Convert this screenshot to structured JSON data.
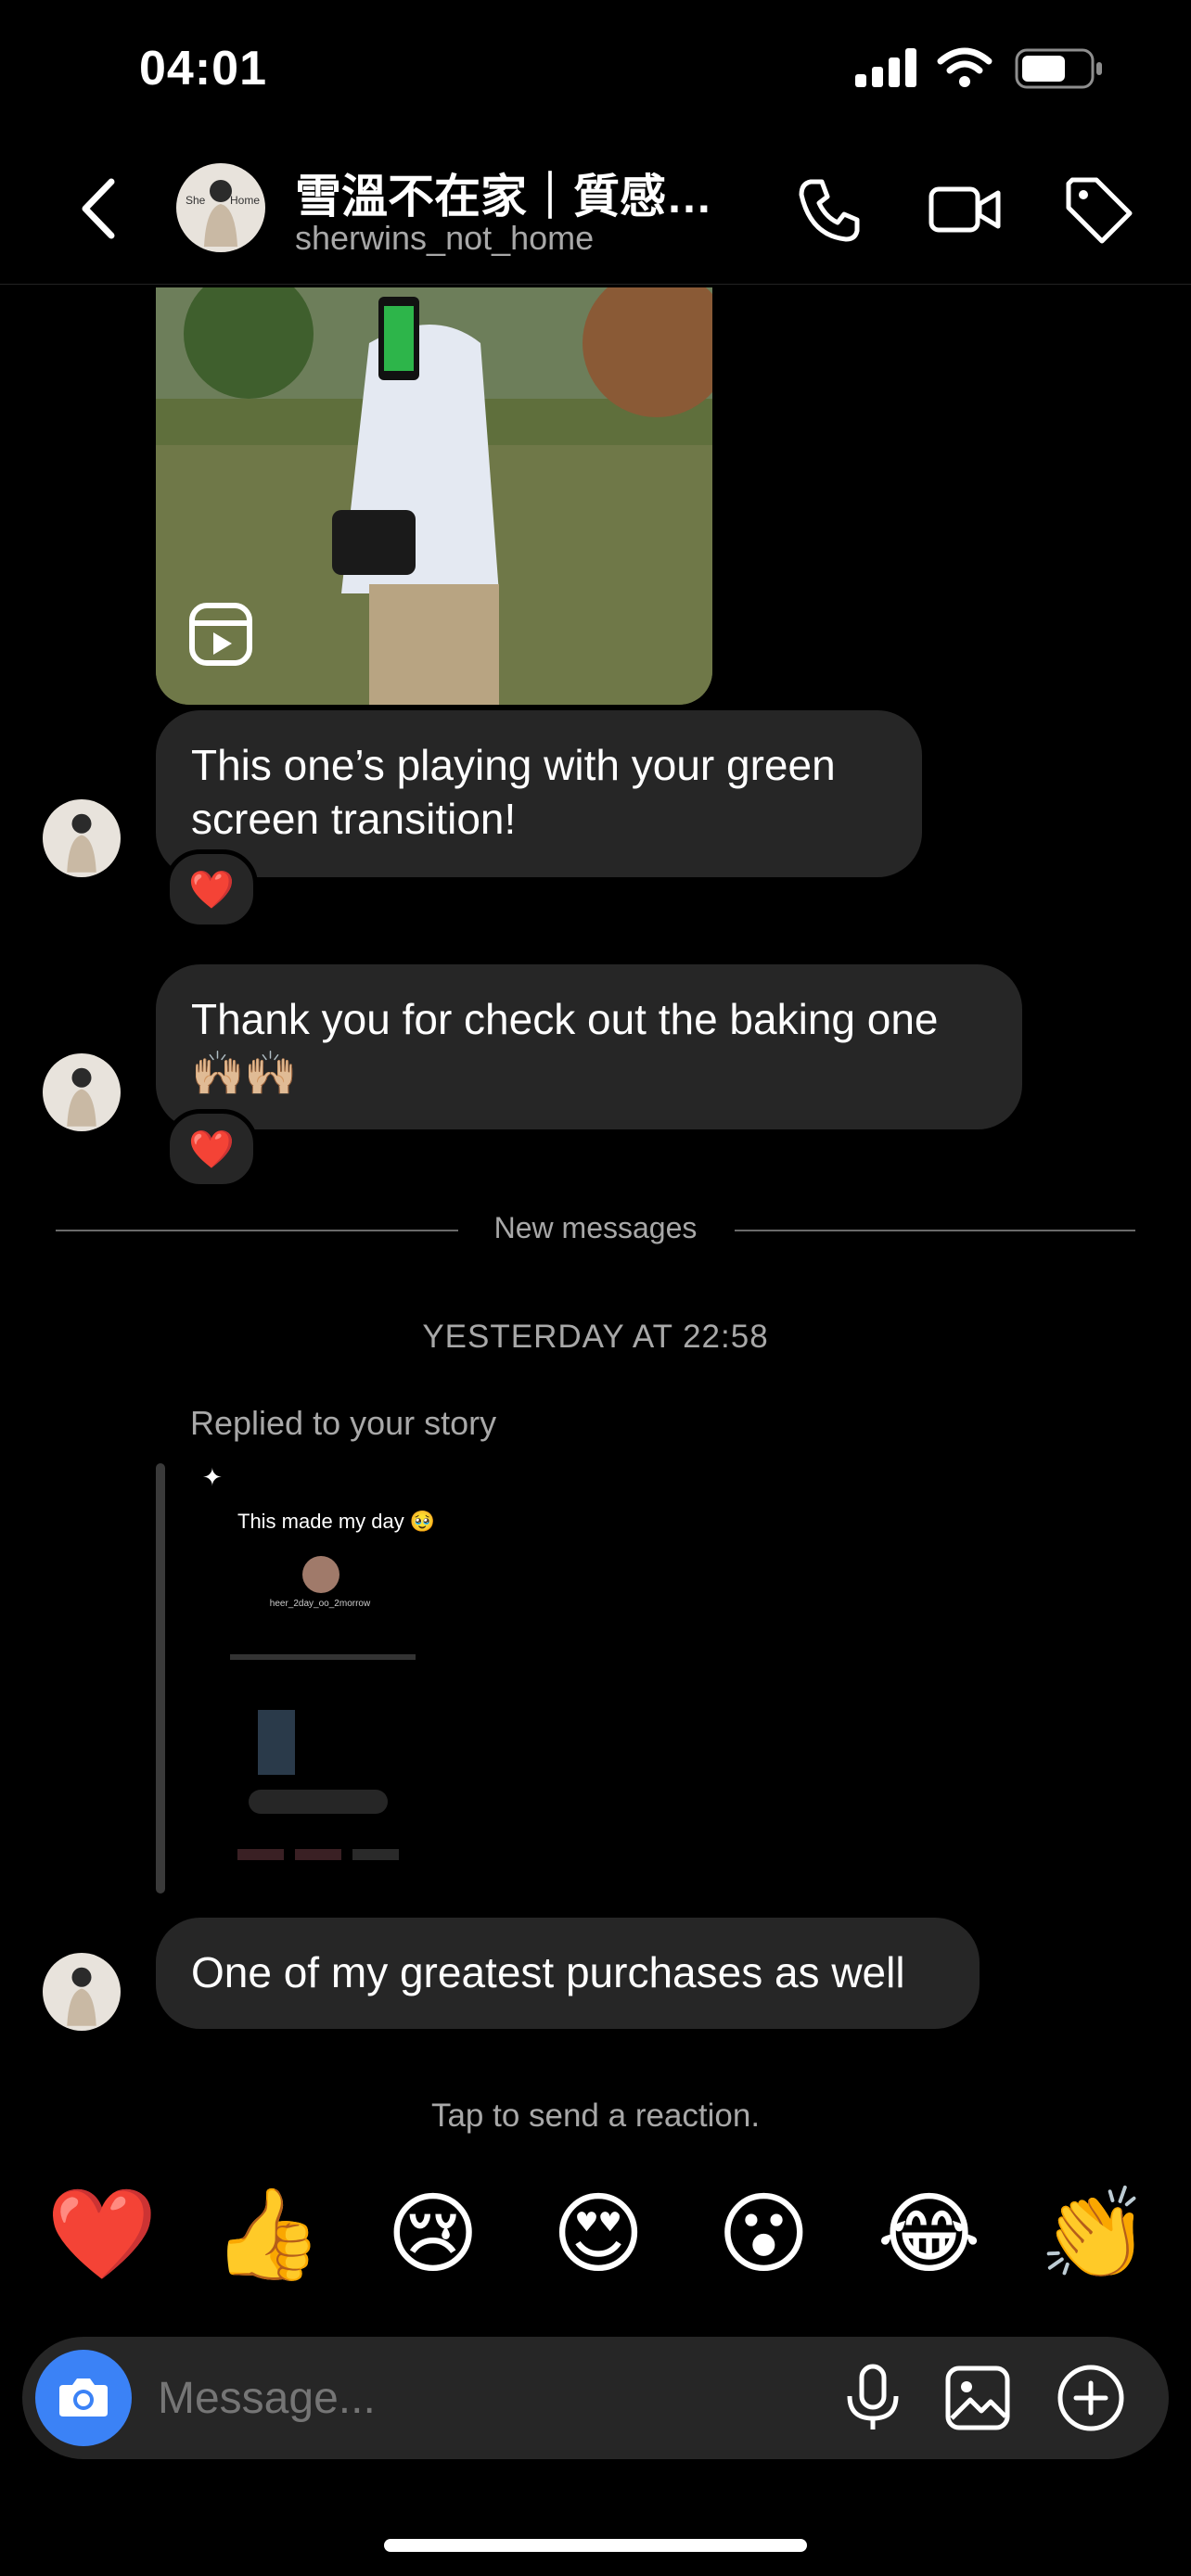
{
  "status_bar": {
    "time": "04:01"
  },
  "header": {
    "title": "雪溫不在家｜質感…",
    "username": "sherwins_not_home",
    "avatar_text": "She Home"
  },
  "messages": [
    {
      "text": "This one’s playing with your green screen transition!",
      "reaction": "❤️"
    },
    {
      "text": "Thank you for check out the baking one 🙌🏼🙌🏼",
      "reaction": "❤️"
    }
  ],
  "divider": {
    "label": "New messages"
  },
  "timestamp": "YESTERDAY AT 22:58",
  "story_reply": {
    "label": "Replied to your story",
    "story_caption": "This made my day 🥹",
    "story_username": "heer_2day_oo_2morrow"
  },
  "last_message": {
    "text": "One of my greatest purchases as well"
  },
  "reaction_hint": "Tap to send a reaction.",
  "quick_reactions": [
    "❤️",
    "👍",
    "😢",
    "😍",
    "😮",
    "😂",
    "👏"
  ],
  "composer": {
    "placeholder": "Message..."
  },
  "colors": {
    "background": "#000000",
    "bubble": "#262626",
    "accent": "#3b82f6",
    "secondary_text": "#a8a8a8"
  },
  "icons": [
    "back-chevron-icon",
    "phone-icon",
    "video-camera-icon",
    "tag-icon",
    "camera-icon",
    "microphone-icon",
    "gallery-icon",
    "plus-circle-icon",
    "reels-icon"
  ]
}
